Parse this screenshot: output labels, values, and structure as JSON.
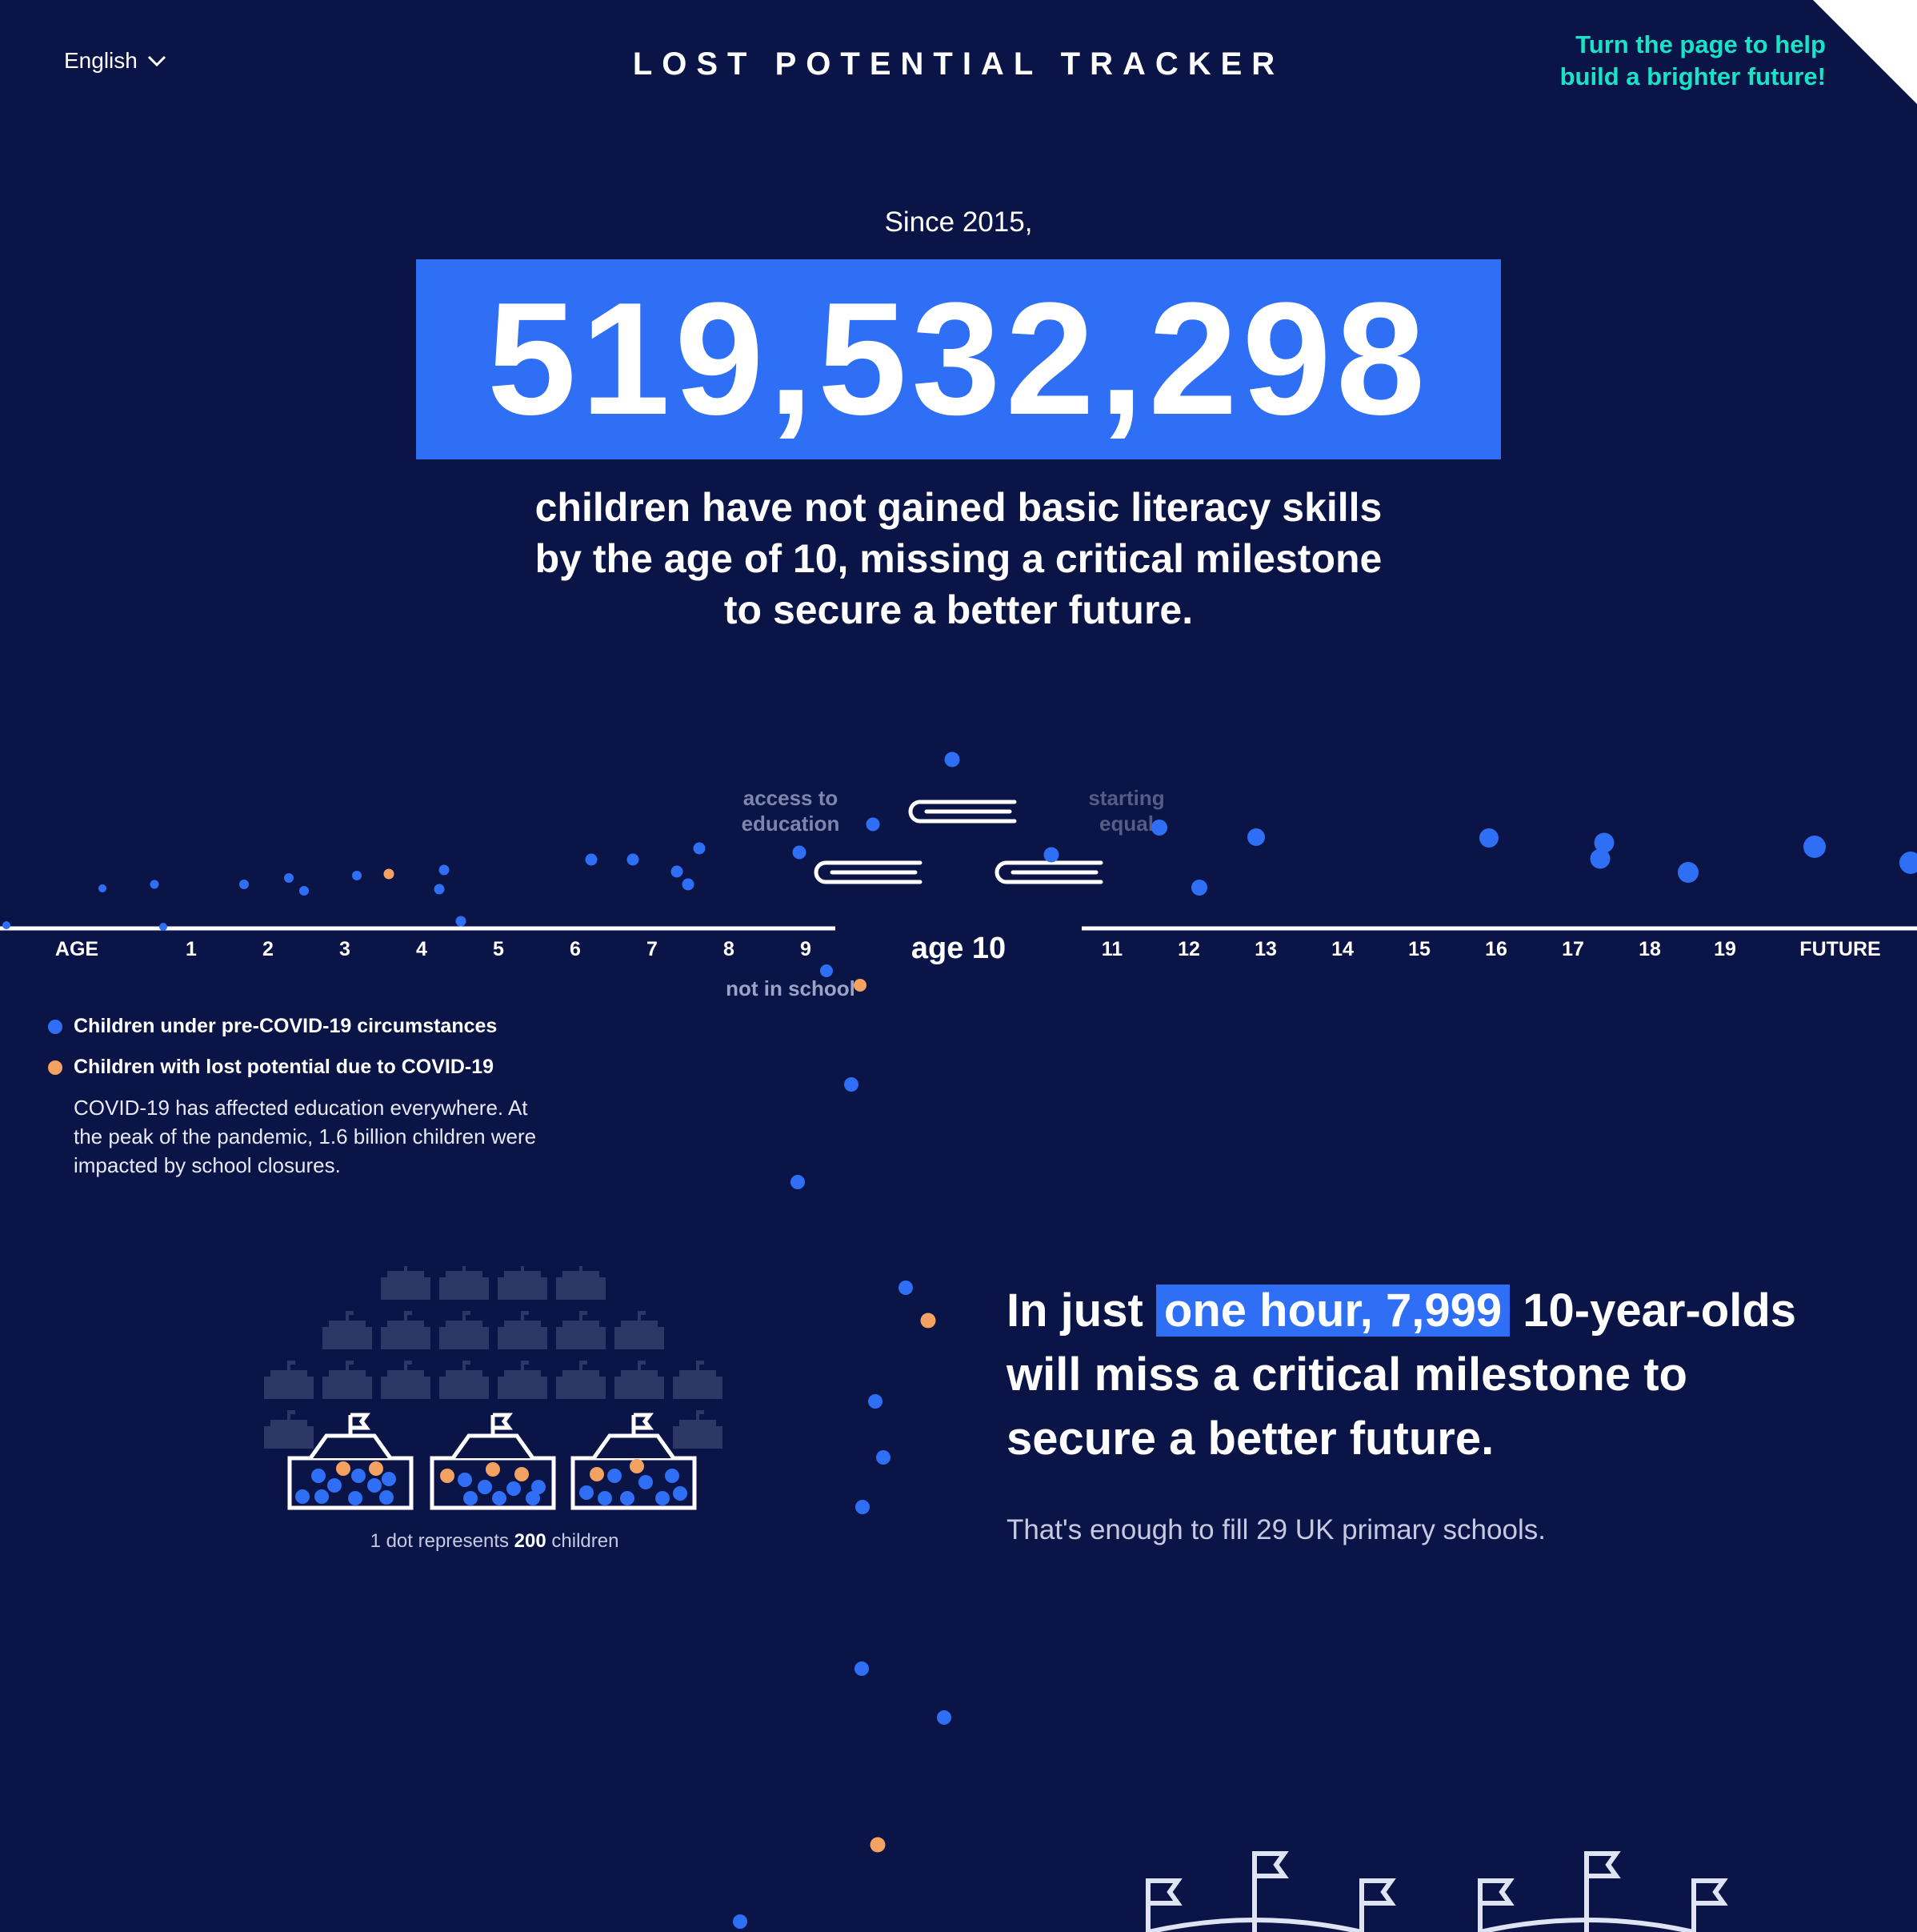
{
  "header": {
    "language": "English",
    "title": "LOST POTENTIAL TRACKER",
    "promo_line1": "Turn the page to help",
    "promo_line2": "build a brighter future!"
  },
  "hero": {
    "since": "Since 2015,",
    "counter": "519,532,298",
    "desc_line1": "children have not gained basic literacy skills",
    "desc_line2": "by the age of 10, missing a critical milestone",
    "desc_line3": "to secure a better future."
  },
  "timeline": {
    "age_title": "AGE",
    "ages_left": [
      "1",
      "2",
      "3",
      "4",
      "5",
      "6",
      "7",
      "8",
      "9"
    ],
    "center_label": "age 10",
    "ages_right": [
      "11",
      "12",
      "13",
      "14",
      "15",
      "16",
      "17",
      "18",
      "19"
    ],
    "future_label": "FUTURE",
    "annotation_access_1": "access to",
    "annotation_access_2": "education",
    "annotation_equal_1": "starting",
    "annotation_equal_2": "equal",
    "annotation_not_in_school": "not in school",
    "colors": {
      "pre_covid": "#2e6ff5",
      "covid": "#f4a261",
      "background": "#0b1446"
    }
  },
  "legend": {
    "pre_covid": "Children under pre-COVID-19 circumstances",
    "covid": "Children with lost potential due to COVID-19",
    "note": "COVID-19 has affected education everywhere. At the peak of the pandemic, 1.6 billion children were impacted by school closures."
  },
  "schools": {
    "caption_prefix": "1 dot represents",
    "caption_value": "200",
    "caption_suffix": "children"
  },
  "statement": {
    "prefix": "In just",
    "highlight": "one hour, 7,999",
    "rest_line1": "10-year-olds",
    "rest_line2": "will miss a critical milestone to",
    "rest_line3": "secure a better future.",
    "sub": "That's enough to fill 29 UK primary schools."
  }
}
